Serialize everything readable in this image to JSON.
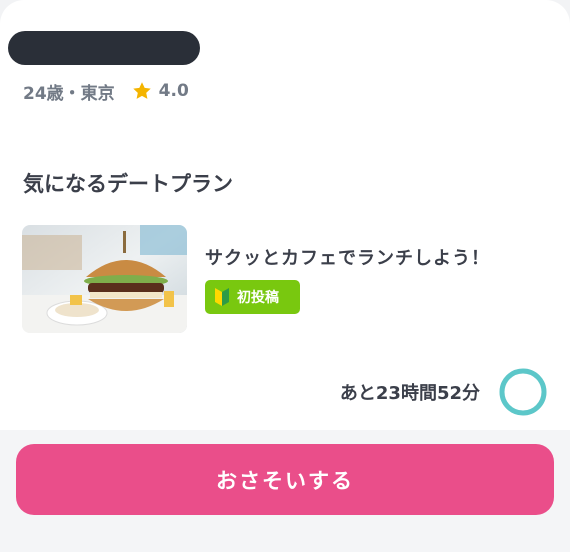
{
  "profile": {
    "age_location": "24歳・東京",
    "rating": "4.0"
  },
  "section": {
    "title": "気になるデートプラン"
  },
  "plan": {
    "title": "サクッとカフェでランチしよう！",
    "badge_label": "初投稿",
    "image_icon": "burger-photo"
  },
  "timer": {
    "remaining_text": "あと23時間52分",
    "progress": 1.0
  },
  "action": {
    "invite_label": "おさそいする"
  },
  "colors": {
    "accent_pink": "#ea4e8a",
    "badge_green": "#79c80f",
    "ring_teal": "#5cc7c9",
    "star_yellow": "#f4b400"
  }
}
